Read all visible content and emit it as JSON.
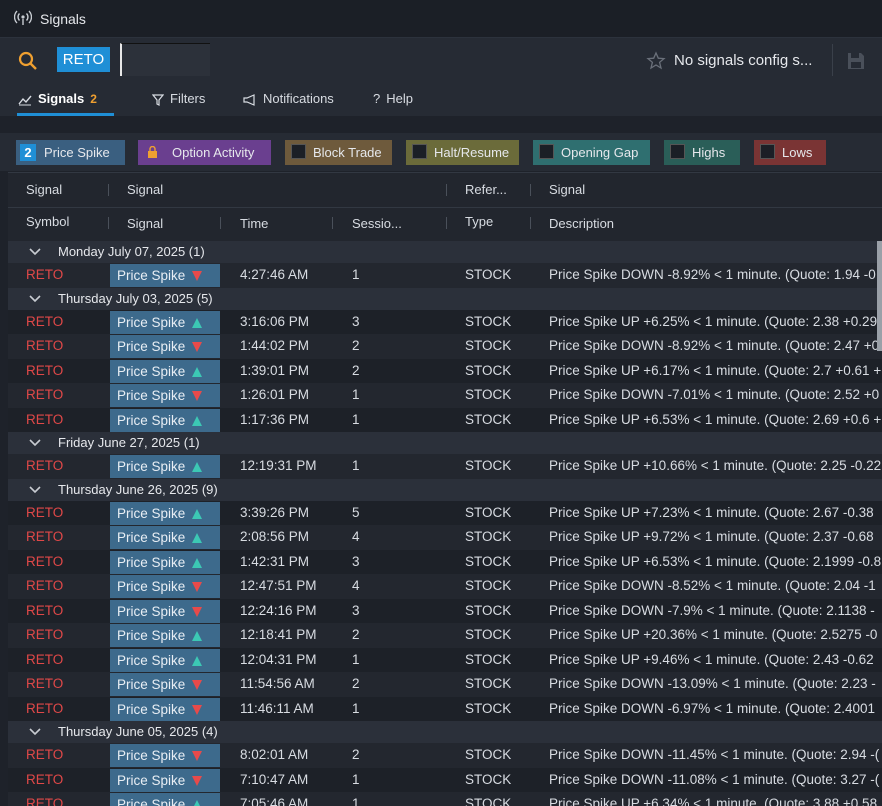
{
  "window": {
    "title": "Signals"
  },
  "toolbar": {
    "symbol": "RETO",
    "config_label": "No signals config s..."
  },
  "tabs": [
    {
      "label": "Signals",
      "count": "2"
    },
    {
      "label": "Filters"
    },
    {
      "label": "Notifications"
    },
    {
      "label": "Help"
    }
  ],
  "legend": [
    {
      "label": "Price Spike",
      "count": "2",
      "color": "#3a5f80"
    },
    {
      "label": "Option Activity",
      "color": "#6a3f8f"
    },
    {
      "label": "Block Trade",
      "color": "#6e5a3c"
    },
    {
      "label": "Halt/Resume",
      "color": "#6b6b3a"
    },
    {
      "label": "Opening Gap",
      "color": "#2f6f70"
    },
    {
      "label": "Highs",
      "color": "#2a5e58"
    },
    {
      "label": "Lows",
      "color": "#7a3434"
    }
  ],
  "headers": {
    "group_row": [
      "Signal",
      "Signal",
      "Refer...",
      "Signal"
    ],
    "col_row": [
      "Symbol",
      "Signal",
      "Time",
      "Sessio...",
      "Type",
      "Description"
    ]
  },
  "groups": [
    {
      "label": "Monday July 07, 2025 (1)",
      "rows": [
        {
          "sym": "RETO",
          "sig": "Price Spike",
          "dir": "down",
          "time": "4:27:46 AM",
          "sess": "1",
          "type": "STOCK",
          "desc": "Price Spike DOWN -8.92% < 1 minute. (Quote: 1.94 -0"
        }
      ]
    },
    {
      "label": "Thursday July 03, 2025 (5)",
      "rows": [
        {
          "sym": "RETO",
          "sig": "Price Spike",
          "dir": "up",
          "time": "3:16:06 PM",
          "sess": "3",
          "type": "STOCK",
          "desc": "Price Spike UP +6.25% < 1 minute. (Quote: 2.38 +0.29"
        },
        {
          "sym": "RETO",
          "sig": "Price Spike",
          "dir": "down",
          "time": "1:44:02 PM",
          "sess": "2",
          "type": "STOCK",
          "desc": "Price Spike DOWN -8.92% < 1 minute. (Quote: 2.47 +0"
        },
        {
          "sym": "RETO",
          "sig": "Price Spike",
          "dir": "up",
          "time": "1:39:01 PM",
          "sess": "2",
          "type": "STOCK",
          "desc": "Price Spike UP +6.17% < 1 minute. (Quote: 2.7 +0.61 +"
        },
        {
          "sym": "RETO",
          "sig": "Price Spike",
          "dir": "down",
          "time": "1:26:01 PM",
          "sess": "1",
          "type": "STOCK",
          "desc": "Price Spike DOWN -7.01% < 1 minute. (Quote: 2.52 +0"
        },
        {
          "sym": "RETO",
          "sig": "Price Spike",
          "dir": "up",
          "time": "1:17:36 PM",
          "sess": "1",
          "type": "STOCK",
          "desc": "Price Spike UP +6.53% < 1 minute. (Quote: 2.69 +0.6 +"
        }
      ]
    },
    {
      "label": "Friday June 27, 2025 (1)",
      "rows": [
        {
          "sym": "RETO",
          "sig": "Price Spike",
          "dir": "up",
          "time": "12:19:31 PM",
          "sess": "1",
          "type": "STOCK",
          "desc": "Price Spike UP +10.66% < 1 minute. (Quote: 2.25 -0.22"
        }
      ]
    },
    {
      "label": "Thursday June 26, 2025 (9)",
      "rows": [
        {
          "sym": "RETO",
          "sig": "Price Spike",
          "dir": "up",
          "time": "3:39:26 PM",
          "sess": "5",
          "type": "STOCK",
          "desc": "Price Spike UP +7.23% < 1 minute. (Quote: 2.67 -0.38"
        },
        {
          "sym": "RETO",
          "sig": "Price Spike",
          "dir": "up",
          "time": "2:08:56 PM",
          "sess": "4",
          "type": "STOCK",
          "desc": "Price Spike UP +9.72% < 1 minute. (Quote: 2.37 -0.68"
        },
        {
          "sym": "RETO",
          "sig": "Price Spike",
          "dir": "up",
          "time": "1:42:31 PM",
          "sess": "3",
          "type": "STOCK",
          "desc": "Price Spike UP +6.53% < 1 minute. (Quote: 2.1999 -0.8"
        },
        {
          "sym": "RETO",
          "sig": "Price Spike",
          "dir": "down",
          "time": "12:47:51 PM",
          "sess": "4",
          "type": "STOCK",
          "desc": "Price Spike DOWN -8.52% < 1 minute. (Quote: 2.04 -1"
        },
        {
          "sym": "RETO",
          "sig": "Price Spike",
          "dir": "down",
          "time": "12:24:16 PM",
          "sess": "3",
          "type": "STOCK",
          "desc": "Price Spike DOWN -7.9% < 1 minute. (Quote: 2.1138 -"
        },
        {
          "sym": "RETO",
          "sig": "Price Spike",
          "dir": "up",
          "time": "12:18:41 PM",
          "sess": "2",
          "type": "STOCK",
          "desc": "Price Spike UP +20.36% < 1 minute. (Quote: 2.5275 -0"
        },
        {
          "sym": "RETO",
          "sig": "Price Spike",
          "dir": "up",
          "time": "12:04:31 PM",
          "sess": "1",
          "type": "STOCK",
          "desc": "Price Spike UP +9.46% < 1 minute. (Quote: 2.43 -0.62"
        },
        {
          "sym": "RETO",
          "sig": "Price Spike",
          "dir": "down",
          "time": "11:54:56 AM",
          "sess": "2",
          "type": "STOCK",
          "desc": "Price Spike DOWN -13.09% < 1 minute. (Quote: 2.23 -"
        },
        {
          "sym": "RETO",
          "sig": "Price Spike",
          "dir": "down",
          "time": "11:46:11 AM",
          "sess": "1",
          "type": "STOCK",
          "desc": "Price Spike DOWN -6.97% < 1 minute. (Quote: 2.4001"
        }
      ]
    },
    {
      "label": "Thursday June 05, 2025 (4)",
      "rows": [
        {
          "sym": "RETO",
          "sig": "Price Spike",
          "dir": "down",
          "time": "8:02:01 AM",
          "sess": "2",
          "type": "STOCK",
          "desc": "Price Spike DOWN -11.45% < 1 minute. (Quote: 2.94 -("
        },
        {
          "sym": "RETO",
          "sig": "Price Spike",
          "dir": "down",
          "time": "7:10:47 AM",
          "sess": "1",
          "type": "STOCK",
          "desc": "Price Spike DOWN -11.08% < 1 minute. (Quote: 3.27 -("
        },
        {
          "sym": "RETO",
          "sig": "Price Spike",
          "dir": "up",
          "time": "7:05:46 AM",
          "sess": "1",
          "type": "STOCK",
          "desc": "Price Spike UP +6.34% < 1 minute. (Quote: 3.88 +0.58"
        }
      ]
    }
  ],
  "colors": {
    "up": "#3cc8b4",
    "down": "#e84a4a",
    "symbol": "#e04848",
    "accent": "#1f8fd6",
    "badge": "#f0a030"
  }
}
